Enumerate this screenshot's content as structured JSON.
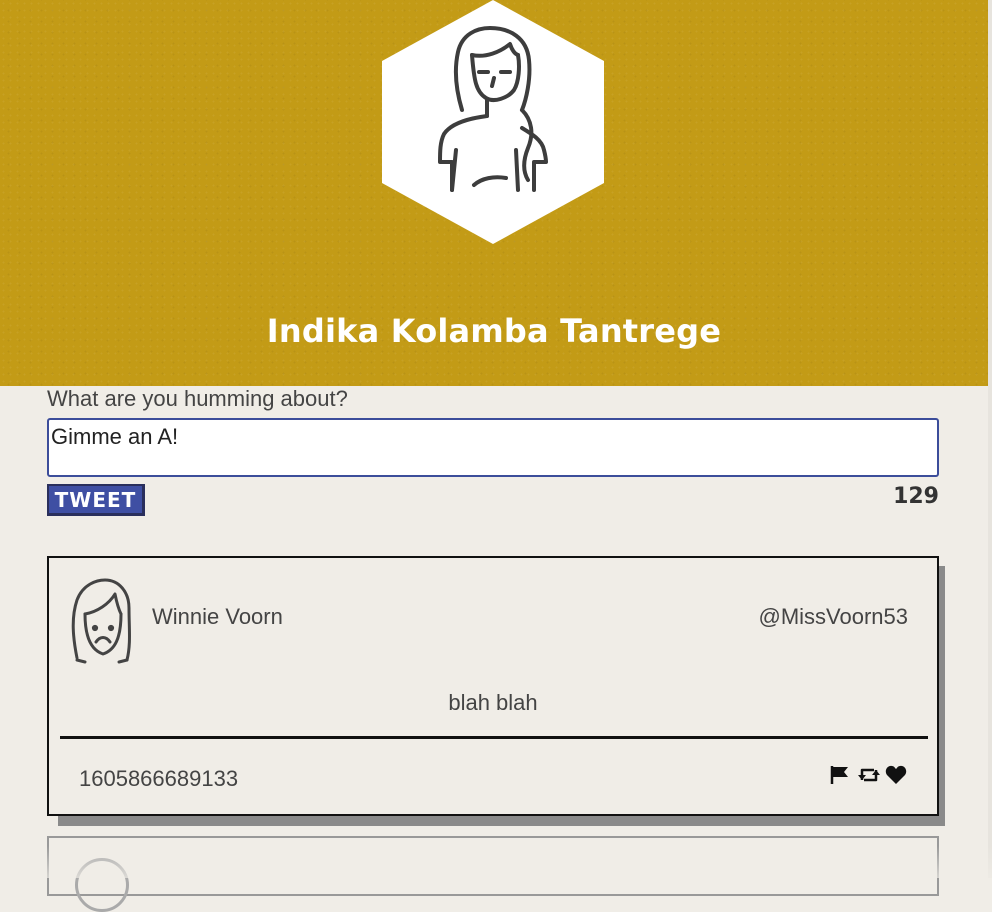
{
  "profile": {
    "name": "Indika Kolamba Tantrege",
    "avatar_icon": "woman-avatar-icon",
    "banner_color": "#c39b16"
  },
  "compose": {
    "label": "What are you humming about?",
    "value": "Gimme an A!",
    "button_label": "TWEET",
    "char_count": "129"
  },
  "tweets": [
    {
      "author": "Winnie Voorn",
      "handle": "@MissVoorn53",
      "content": "blah blah",
      "timestamp": "1605866689133",
      "avatar_icon": "sad-girl-avatar-icon",
      "actions": [
        "flag-icon",
        "retweet-icon",
        "heart-icon"
      ]
    }
  ]
}
